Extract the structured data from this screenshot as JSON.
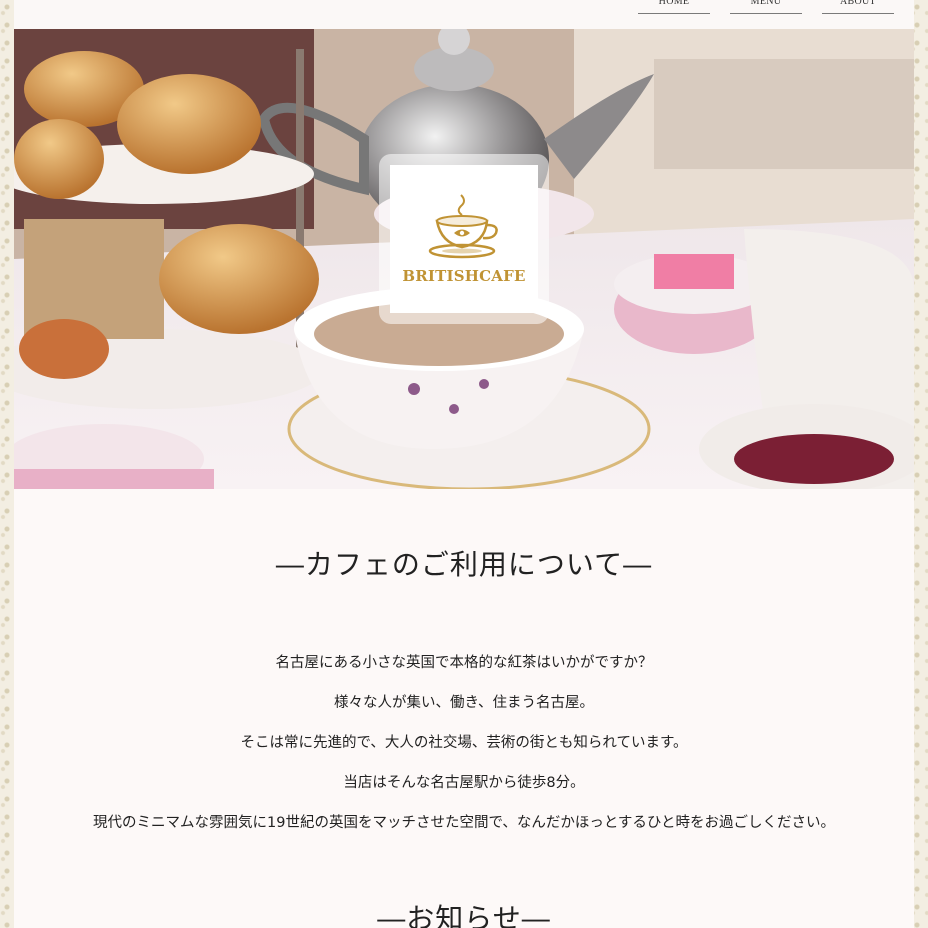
{
  "nav": {
    "home": "HOME",
    "menu": "MENU",
    "about": "ABOUT"
  },
  "logo": {
    "name": "BRITISHCAFE",
    "icon": "teacup-icon"
  },
  "about": {
    "title": "―カフェのご利用について―",
    "lines": [
      "名古屋にある小さな英国で本格的な紅茶はいかがですか？",
      "様々な人が集い、働き、住まう名古屋。",
      "そこは常に先進的で、大人の社交場、芸術の街とも知られています。",
      "当店はそんな名古屋駅から徒歩8分。",
      "現代のミニマムな雰囲気に19世紀の英国をマッチさせた空間で、なんだかほっとするひと時をお過ごしください。"
    ]
  },
  "news": {
    "title": "―お知らせ―"
  },
  "colors": {
    "accent": "#c09334",
    "page_bg": "#fdf9f8",
    "border_pattern": "#d8cfb4"
  }
}
